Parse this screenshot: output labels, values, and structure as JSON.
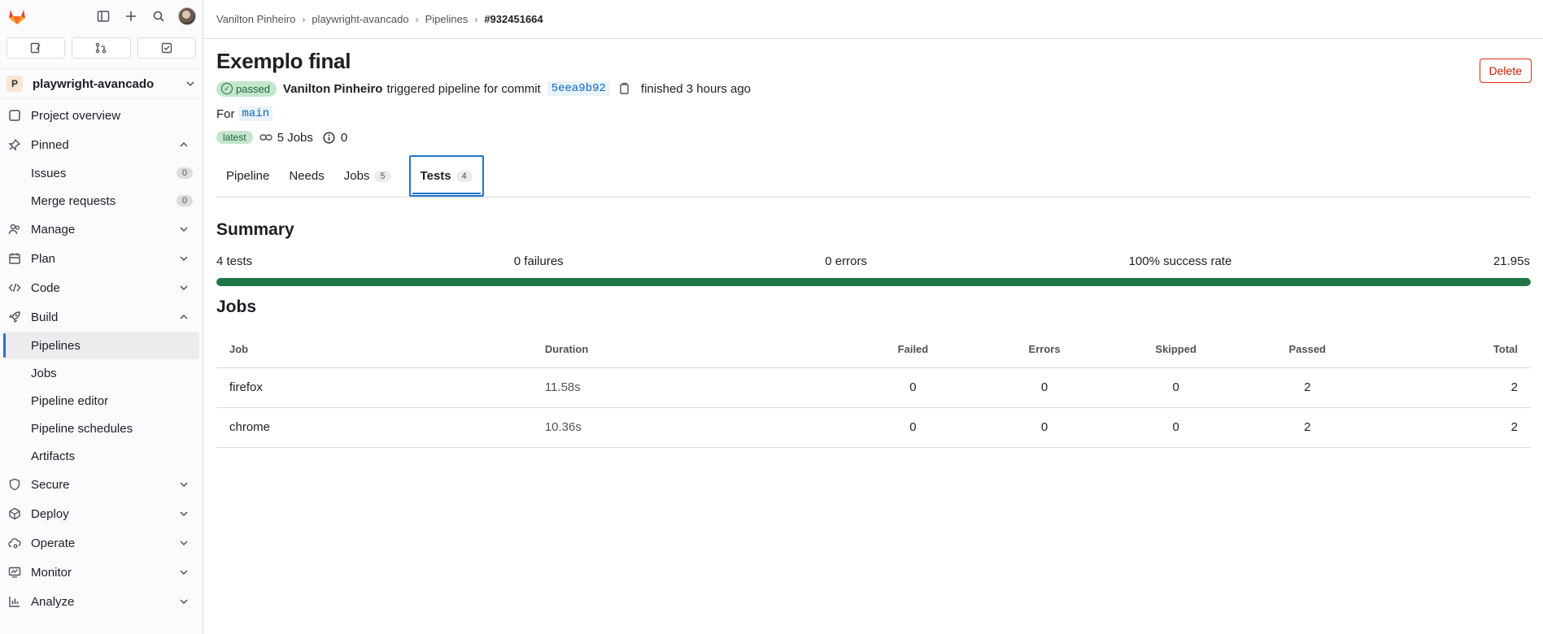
{
  "breadcrumb": [
    "Vanilton Pinheiro",
    "playwright-avancado",
    "Pipelines",
    "#932451664"
  ],
  "sidebar": {
    "project_initial": "P",
    "project_name": "playwright-avancado",
    "overview": "Project overview",
    "pinned": "Pinned",
    "pinned_items": [
      {
        "label": "Issues",
        "count": "0"
      },
      {
        "label": "Merge requests",
        "count": "0"
      }
    ],
    "sections": {
      "manage": "Manage",
      "plan": "Plan",
      "code": "Code",
      "build": "Build",
      "secure": "Secure",
      "deploy": "Deploy",
      "operate": "Operate",
      "monitor": "Monitor",
      "analyze": "Analyze"
    },
    "build_items": [
      "Pipelines",
      "Jobs",
      "Pipeline editor",
      "Pipeline schedules",
      "Artifacts"
    ]
  },
  "pipeline": {
    "title": "Exemplo final",
    "delete_label": "Delete",
    "status": "passed",
    "author": "Vanilton Pinheiro",
    "triggered_text": "triggered pipeline for commit",
    "commit": "5eea9b92",
    "finished": "finished 3 hours ago",
    "for_label": "For",
    "branch": "main",
    "latest": "latest",
    "jobs_count_label": "5 Jobs",
    "needs_count": "0"
  },
  "tabs": [
    {
      "label": "Pipeline",
      "count": ""
    },
    {
      "label": "Needs",
      "count": ""
    },
    {
      "label": "Jobs",
      "count": "5"
    },
    {
      "label": "Tests",
      "count": "4"
    }
  ],
  "summary": {
    "heading": "Summary",
    "tests": "4 tests",
    "failures": "0 failures",
    "errors": "0 errors",
    "success_rate": "100% success rate",
    "duration": "21.95s",
    "success_fraction": 1.0,
    "bar_color": "#217645"
  },
  "jobs": {
    "heading": "Jobs",
    "columns": [
      "Job",
      "Duration",
      "Failed",
      "Errors",
      "Skipped",
      "Passed",
      "Total"
    ],
    "rows": [
      {
        "job": "firefox",
        "duration": "11.58s",
        "failed": "0",
        "errors": "0",
        "skipped": "0",
        "passed": "2",
        "total": "2"
      },
      {
        "job": "chrome",
        "duration": "10.36s",
        "failed": "0",
        "errors": "0",
        "skipped": "0",
        "passed": "2",
        "total": "2"
      }
    ]
  }
}
